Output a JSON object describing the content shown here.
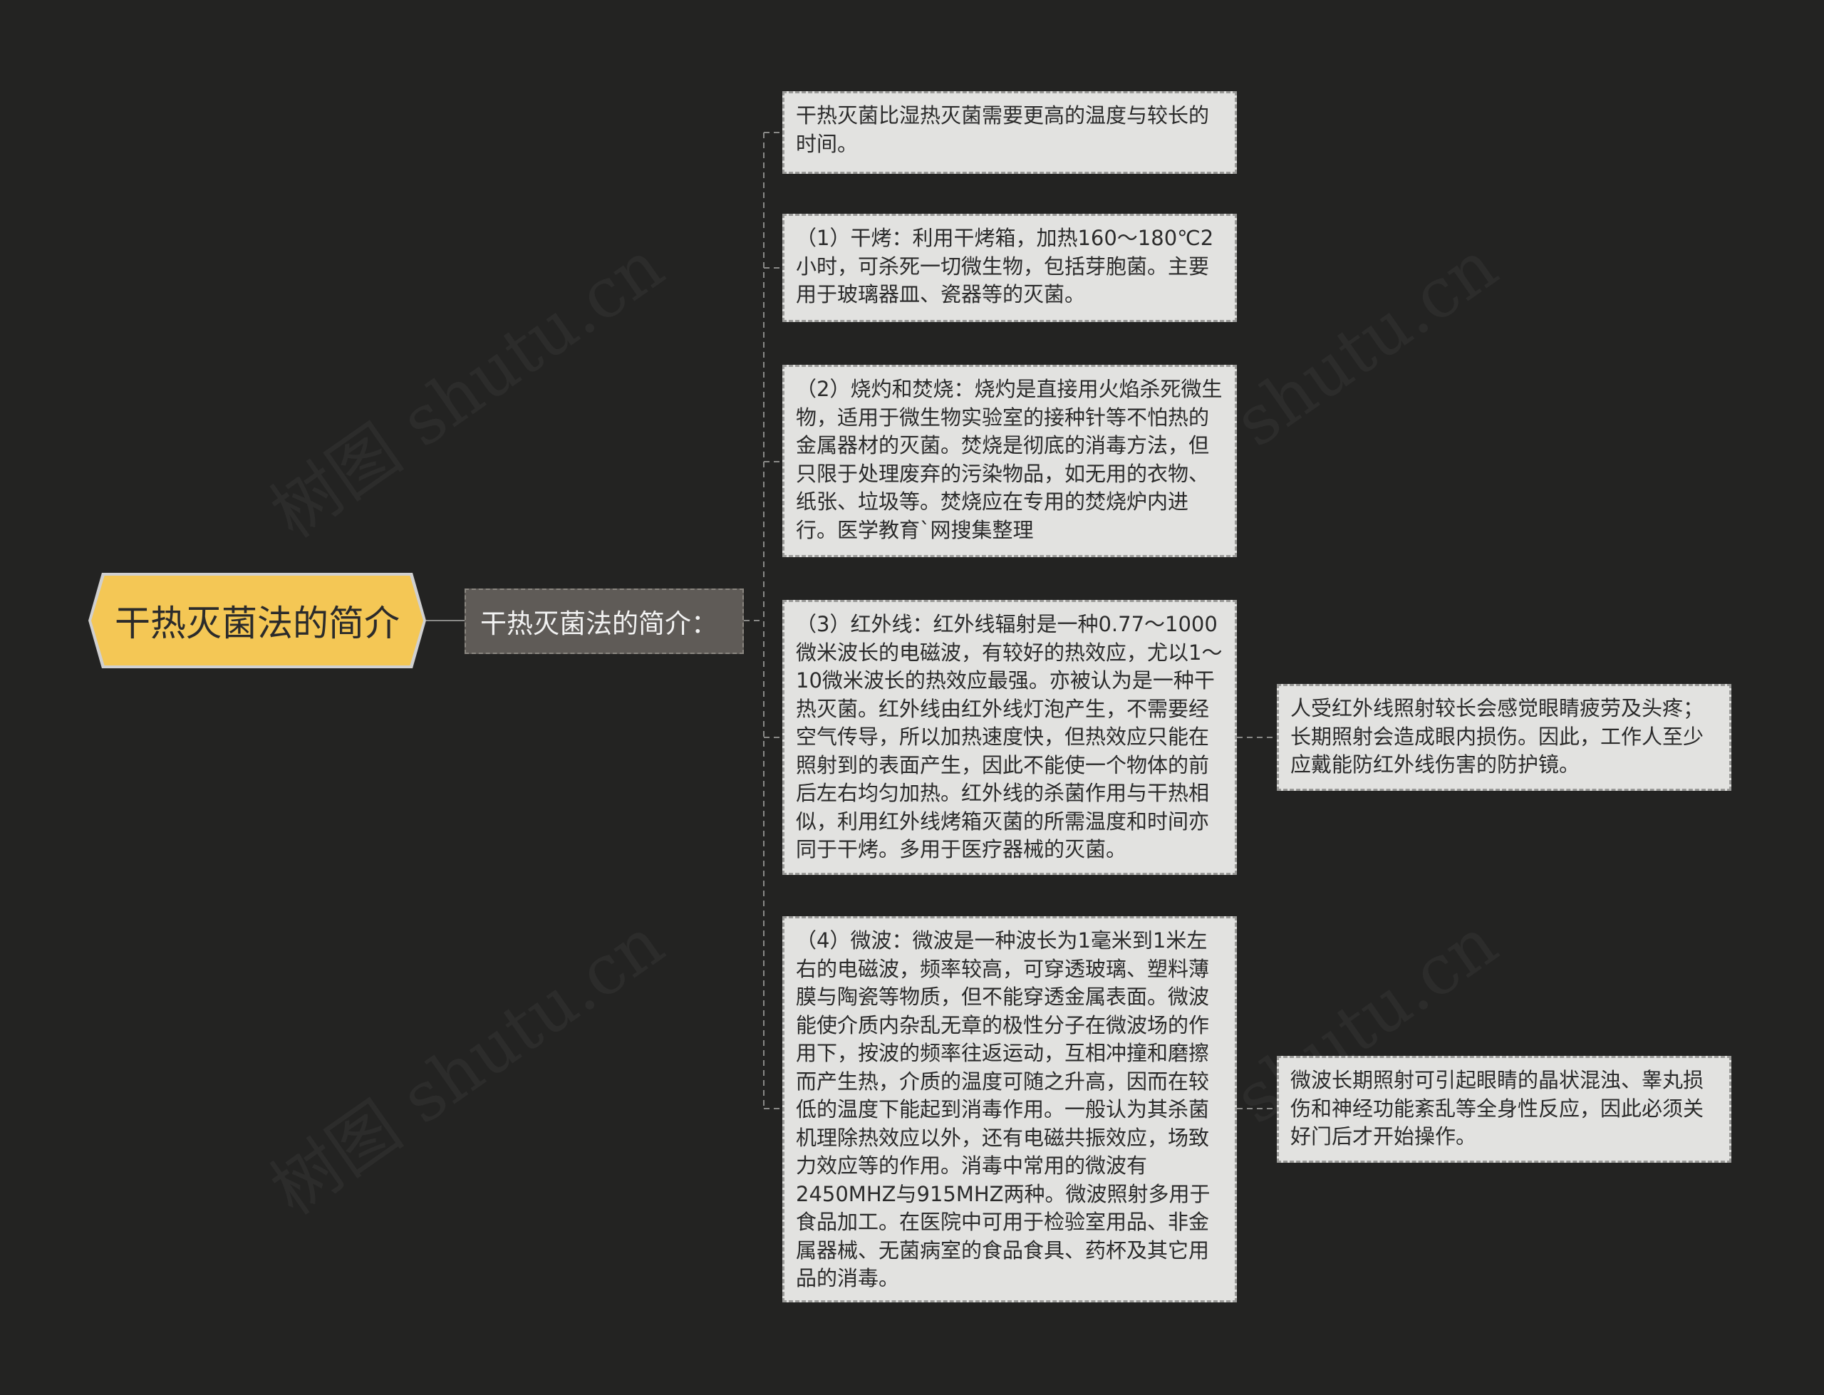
{
  "root": {
    "label": "干热灭菌法的简介"
  },
  "branch": {
    "label": "干热灭菌法的简介："
  },
  "leaves": [
    {
      "text": "干热灭菌比湿热灭菌需要更高的温度与较长的时间。"
    },
    {
      "text": "（1）干烤：利用干烤箱，加热160～180℃2小时，可杀死一切微生物，包括芽胞菌。主要用于玻璃器皿、瓷器等的灭菌。"
    },
    {
      "text": "（2）烧灼和焚烧：烧灼是直接用火焰杀死微生物，适用于微生物实验室的接种针等不怕热的金属器材的灭菌。焚烧是彻底的消毒方法，但只限于处理废弃的污染物品，如无用的衣物、纸张、垃圾等。焚烧应在专用的焚烧炉内进行。医学教育`网搜集整理"
    },
    {
      "text": "（3）红外线：红外线辐射是一种0.77～1000微米波长的电磁波，有较好的热效应，尤以1～10微米波长的热效应最强。亦被认为是一种干热灭菌。红外线由红外线灯泡产生，不需要经空气传导，所以加热速度快，但热效应只能在照射到的表面产生，因此不能使一个物体的前后左右均匀加热。红外线的杀菌作用与干热相似，利用红外线烤箱灭菌的所需温度和时间亦同于干烤。多用于医疗器械的灭菌。"
    },
    {
      "text": "（4）微波：微波是一种波长为1毫米到1米左右的电磁波，频率较高，可穿透玻璃、塑料薄膜与陶瓷等物质，但不能穿透金属表面。微波能使介质内杂乱无章的极性分子在微波场的作用下，按波的频率往返运动，互相冲撞和磨擦而产生热，介质的温度可随之升高，因而在较低的温度下能起到消毒作用。一般认为其杀菌机理除热效应以外，还有电磁共振效应，场致力效应等的作用。消毒中常用的微波有2450MHZ与915MHZ两种。微波照射多用于食品加工。在医院中可用于检验室用品、非金属器械、无菌病室的食品食具、药杯及其它用品的消毒。"
    }
  ],
  "sub_leaves": [
    {
      "text": "人受红外线照射较长会感觉眼睛疲劳及头疼；长期照射会造成眼内损伤。因此，工作人至少应戴能防红外线伤害的防护镜。"
    },
    {
      "text": "微波长期照射可引起眼睛的晶状混浊、睾丸损伤和神经功能紊乱等全身性反应，因此必须关好门后才开始操作。"
    }
  ],
  "watermark": "树图 shutu.cn",
  "colors": {
    "background": "#232322",
    "root_fill": "#f4c755",
    "branch_fill": "#5f5b57",
    "leaf_fill": "#e2e2e0",
    "connector": "#8a8a88"
  }
}
